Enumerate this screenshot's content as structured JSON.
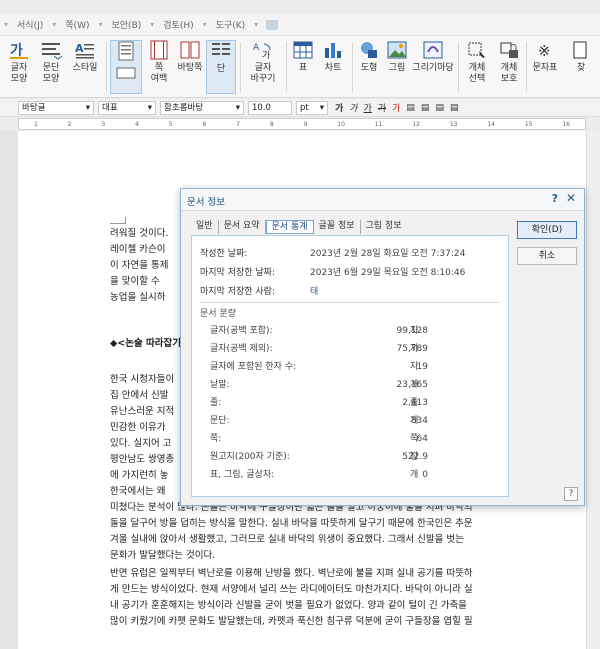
{
  "menubar": {
    "items": [
      "서식(J)",
      "쪽(W)",
      "보안(B)",
      "검토(H)",
      "도구(K)"
    ]
  },
  "ribbon": {
    "buttons": [
      {
        "label1": "글자",
        "label2": "모양"
      },
      {
        "label1": "문단",
        "label2": "모양"
      },
      {
        "label1": "스타일",
        "label2": ""
      },
      {
        "label1": "",
        "label2": ""
      },
      {
        "label1": "쪽",
        "label2": "여백"
      },
      {
        "label1": "바탕쪽",
        "label2": ""
      },
      {
        "label1": "단",
        "label2": ""
      },
      {
        "label1": "글자",
        "label2": "바꾸기"
      },
      {
        "label1": "표",
        "label2": ""
      },
      {
        "label1": "차트",
        "label2": ""
      },
      {
        "label1": "도형",
        "label2": ""
      },
      {
        "label1": "그림",
        "label2": ""
      },
      {
        "label1": "그리기마당",
        "label2": ""
      },
      {
        "label1": "개체",
        "label2": "선택"
      },
      {
        "label1": "개체",
        "label2": "보호"
      },
      {
        "label1": "문자표",
        "label2": ""
      },
      {
        "label1": "찾",
        "label2": ""
      }
    ]
  },
  "formatbar": {
    "style": "바탕글",
    "lang": "대표",
    "font": "함초롬바탕",
    "size": "10.0",
    "unit": "pt",
    "bold": "가",
    "italic": "가",
    "underline": "가",
    "strike": "가",
    "color": "가"
  },
  "ruler": {
    "ticks": [
      "1",
      "2",
      "3",
      "4",
      "5",
      "6",
      "7",
      "8",
      "9",
      "10",
      "11",
      "12",
      "13",
      "14",
      "15",
      "16"
    ]
  },
  "document": {
    "lines": [
      "려워질 것이다.",
      "레이첼 카슨이",
      "이 자연을 통제",
      "을 맞이할 수",
      "농업을 실시하",
      "◆<논술 따라잡기",
      "한국 시청자들이",
      "집 안에서 신발",
      "유난스러운 지적",
      "민감한 이유가",
      "있다. 실지어 고",
      "평안남도 쌍영총",
      "에 가지런히 놓",
      "한국에서는 왜",
      "미쳤다는 분석이 많다. 온돌은 바닥에 구들장이란 넓은 돌을 깔고 아궁이에 불을 지펴 바닥의",
      "돌을 달구어 방을 덥히는 방식을 말한다. 실내 바닥을 따뜻하게 달구기 때문에 한국인은 추운",
      "겨울 실내에 앉아서 생활했고, 그러므로 실내 바닥의 위생이 중요했다. 그래서 신발을 벗는",
      "문화가 발달했다는 것이다.",
      "반면 유럽은 일찍부터 벽난로를 이용해 난방을 했다. 벽난로에 불을 지펴 실내 공기를 따뜻하",
      "게 만드는 방식이었다. 현재 서양에서 널리 쓰는 라디에이터도 마찬가지다. 바닥이 아니라 실",
      "내 공기가 훈훈해지는 방식이라 신발을 굳이 벗을 필요가 없었다. 양과 같이 털이 긴 가축을",
      "많이 키웠기에 카펫 문화도 발달했는데, 카펫과 푹신한 침구류 덕분에 굳이 구들장을 엽힐 필"
    ]
  },
  "dialog": {
    "title": "문서 정보",
    "help": "?",
    "close": "✕",
    "tabs": [
      "일반",
      "문서 요약",
      "문서 통계",
      "글꼴 정보",
      "그림 정보"
    ],
    "created_label": "작성한 날짜:",
    "created_value": "2023년 2월 28일 화요일 오전 7:37:24",
    "modified_label": "마지막 저장한 날짜:",
    "modified_value": "2023년 6월 29일 목요일 오전 8:10:46",
    "saver_label": "마지막 저장한 사람:",
    "saver_value": "태",
    "section_label": "문서 분량",
    "stats": [
      {
        "label": "글자(공백 포함):",
        "value": "99,128",
        "unit": "자"
      },
      {
        "label": "글자(공백 제외):",
        "value": "75,789",
        "unit": "자"
      },
      {
        "label": "글자에 포함된 한자 수:",
        "value": "19",
        "unit": "자"
      },
      {
        "label": "낱말:",
        "value": "23,165",
        "unit": "개"
      },
      {
        "label": "줄:",
        "value": "2,413",
        "unit": "줄"
      },
      {
        "label": "문단:",
        "value": "834",
        "unit": "개"
      },
      {
        "label": "쪽:",
        "value": "64",
        "unit": "쪽"
      },
      {
        "label": "원고지(200자 기준):",
        "value": "522.9",
        "unit": "장"
      },
      {
        "label": "표, 그림, 글상자:",
        "value": "0",
        "unit": "개"
      }
    ],
    "ok_label": "확인(D)",
    "cancel_label": "취소",
    "question_label": "?"
  },
  "colors": {
    "accent": "#3d7bc1",
    "dialog_border": "#8fb4d6",
    "title_text": "#1f4f82"
  }
}
